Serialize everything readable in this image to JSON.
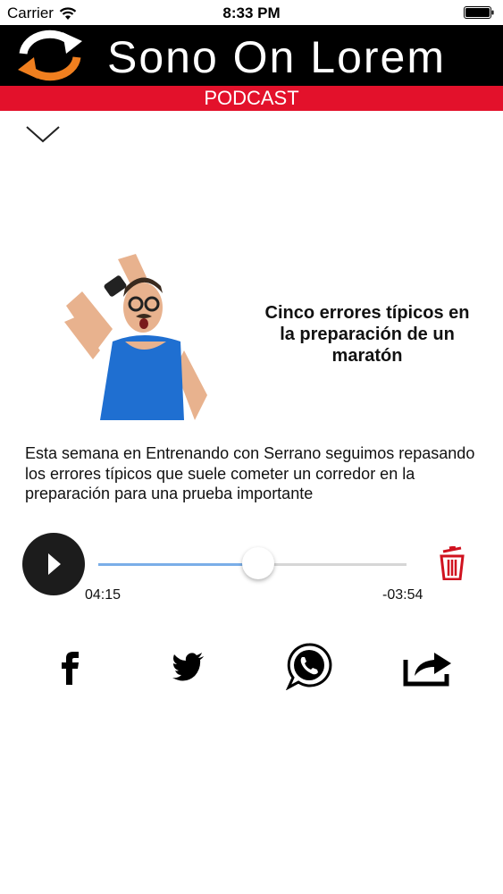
{
  "status_bar": {
    "carrier": "Carrier",
    "time": "8:33 PM"
  },
  "header": {
    "app_title": "Sono On Lorem",
    "section": "PODCAST"
  },
  "episode": {
    "title": "Cinco errores típicos en la preparación de un maratón",
    "description": "Esta semana en Entrenando con Serrano seguimos repasando los errores típicos que suele cometer un corredor en la preparación para una prueba importante"
  },
  "player": {
    "elapsed": "04:15",
    "remaining": "-03:54",
    "progress": 0.52
  },
  "colors": {
    "header_bg": "#000000",
    "section_bar": "#e3112b",
    "logo_orange": "#f07f1f",
    "progress_fill": "#7aaee8",
    "delete_red": "#d0121f"
  },
  "icons": {
    "collapse": "chevron-down-icon",
    "play": "play-icon",
    "delete": "trash-icon",
    "facebook": "facebook-icon",
    "twitter": "twitter-icon",
    "whatsapp": "whatsapp-icon",
    "share": "share-icon"
  }
}
